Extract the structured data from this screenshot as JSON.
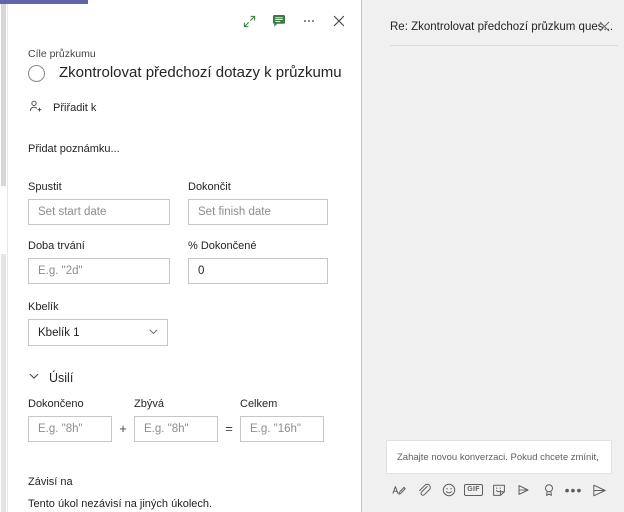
{
  "theme": {
    "accent": "#6264a7",
    "chat_bg": "#f0f0f0",
    "border": "#c8c6c4",
    "text": "#252423",
    "muted": "#8f8d8b",
    "green": "#3a7d44"
  },
  "task_pane": {
    "toolbar": {
      "expand_label": "Rozbalit",
      "chat_label": "Konverzace",
      "more_label": "Další možnosti",
      "close_label": "Zavřít"
    },
    "goal_label": "Cíle průzkumu",
    "task_title": "Zkontrolovat předchozí dotazy k průzkumu",
    "assign_label": "Přiřadit k",
    "note_placeholder": "Přidat poznámku...",
    "fields": {
      "start": {
        "label": "Spustit",
        "value": "",
        "placeholder": "Set start date"
      },
      "finish": {
        "label": "Dokončit",
        "value": "",
        "placeholder": "Set finish date"
      },
      "duration": {
        "label": "Doba trvání",
        "value": "",
        "placeholder": "E.g. \"2d\""
      },
      "percent": {
        "label": "% Dokončené",
        "value": "0",
        "placeholder": "0"
      },
      "bucket": {
        "label": "Kbelík",
        "value": "Kbelík 1"
      }
    },
    "effort": {
      "title": "Úsilí",
      "completed": {
        "label": "Dokončeno",
        "value": "",
        "placeholder": "E.g. \"8h\""
      },
      "remaining": {
        "label": "Zbývá",
        "value": "",
        "placeholder": "E.g. \"8h\""
      },
      "total": {
        "label": "Celkem",
        "value": "",
        "placeholder": "E.g. \"16h\""
      },
      "operator_plus": "+",
      "operator_equals": "="
    },
    "depends": {
      "label": "Závisí na",
      "description": "Tento úkol nezávisí na jiných úkolech."
    }
  },
  "chat_pane": {
    "title": "Re: Zkontrolovat předchozí průzkum ques...",
    "close_label": "Zavřít",
    "compose": {
      "placeholder": "Zahajte novou konverzaci. Pokud chcete zmínit, zadejte @...",
      "value": "",
      "toolbar": {
        "format": "Formát",
        "attach": "Připojit",
        "emoji": "Emoji",
        "gif": "GIF",
        "sticker": "Nálepka",
        "stream": "Stream",
        "praise": "Pochvala",
        "more": "Další možnosti",
        "send": "Odeslat"
      }
    }
  }
}
